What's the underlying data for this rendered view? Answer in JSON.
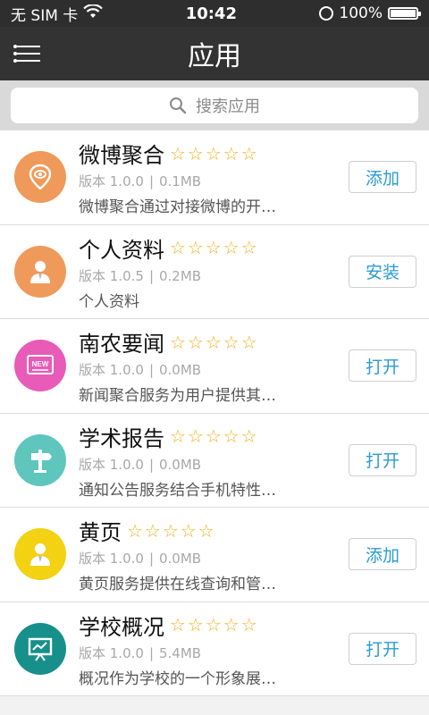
{
  "status_bar": {
    "carrier": "无 SIM 卡",
    "time": "10:42",
    "battery": "100%"
  },
  "header": {
    "title": "应用"
  },
  "search": {
    "placeholder": "搜索应用"
  },
  "apps": [
    {
      "name": "微博聚合",
      "rating_stars": "☆☆☆☆☆",
      "version": "版本 1.0.0",
      "size": "0.1MB",
      "description": "微博聚合通过对接微博的开…",
      "action": "添加",
      "icon": "weibo-pin-icon",
      "color": "#ef9a5a"
    },
    {
      "name": "个人资料",
      "rating_stars": "☆☆☆☆☆",
      "version": "版本 1.0.5",
      "size": "0.2MB",
      "description": "个人资料",
      "action": "安装",
      "icon": "person-icon",
      "color": "#ef9a5a"
    },
    {
      "name": "南农要闻",
      "rating_stars": "☆☆☆☆☆",
      "version": "版本 1.0.0",
      "size": "0.0MB",
      "description": "新闻聚合服务为用户提供其…",
      "action": "打开",
      "icon": "news-icon",
      "color": "#e85bb8"
    },
    {
      "name": "学术报告",
      "rating_stars": "☆☆☆☆☆",
      "version": "版本 1.0.0",
      "size": "0.0MB",
      "description": "通知公告服务结合手机特性…",
      "action": "打开",
      "icon": "signpost-icon",
      "color": "#5fc6be"
    },
    {
      "name": "黄页",
      "rating_stars": "☆☆☆☆☆",
      "version": "版本 1.0.0",
      "size": "0.0MB",
      "description": "黄页服务提供在线查询和管…",
      "action": "添加",
      "icon": "person-icon",
      "color": "#f2d212"
    },
    {
      "name": "学校概况",
      "rating_stars": "☆☆☆☆☆",
      "version": "版本 1.0.0",
      "size": "5.4MB",
      "description": "概况作为学校的一个形象展…",
      "action": "打开",
      "icon": "presentation-icon",
      "color": "#17908c"
    }
  ],
  "colors": {
    "header_bg": "#333333",
    "accent": "#2b9bd4",
    "star": "#f2b01e"
  }
}
